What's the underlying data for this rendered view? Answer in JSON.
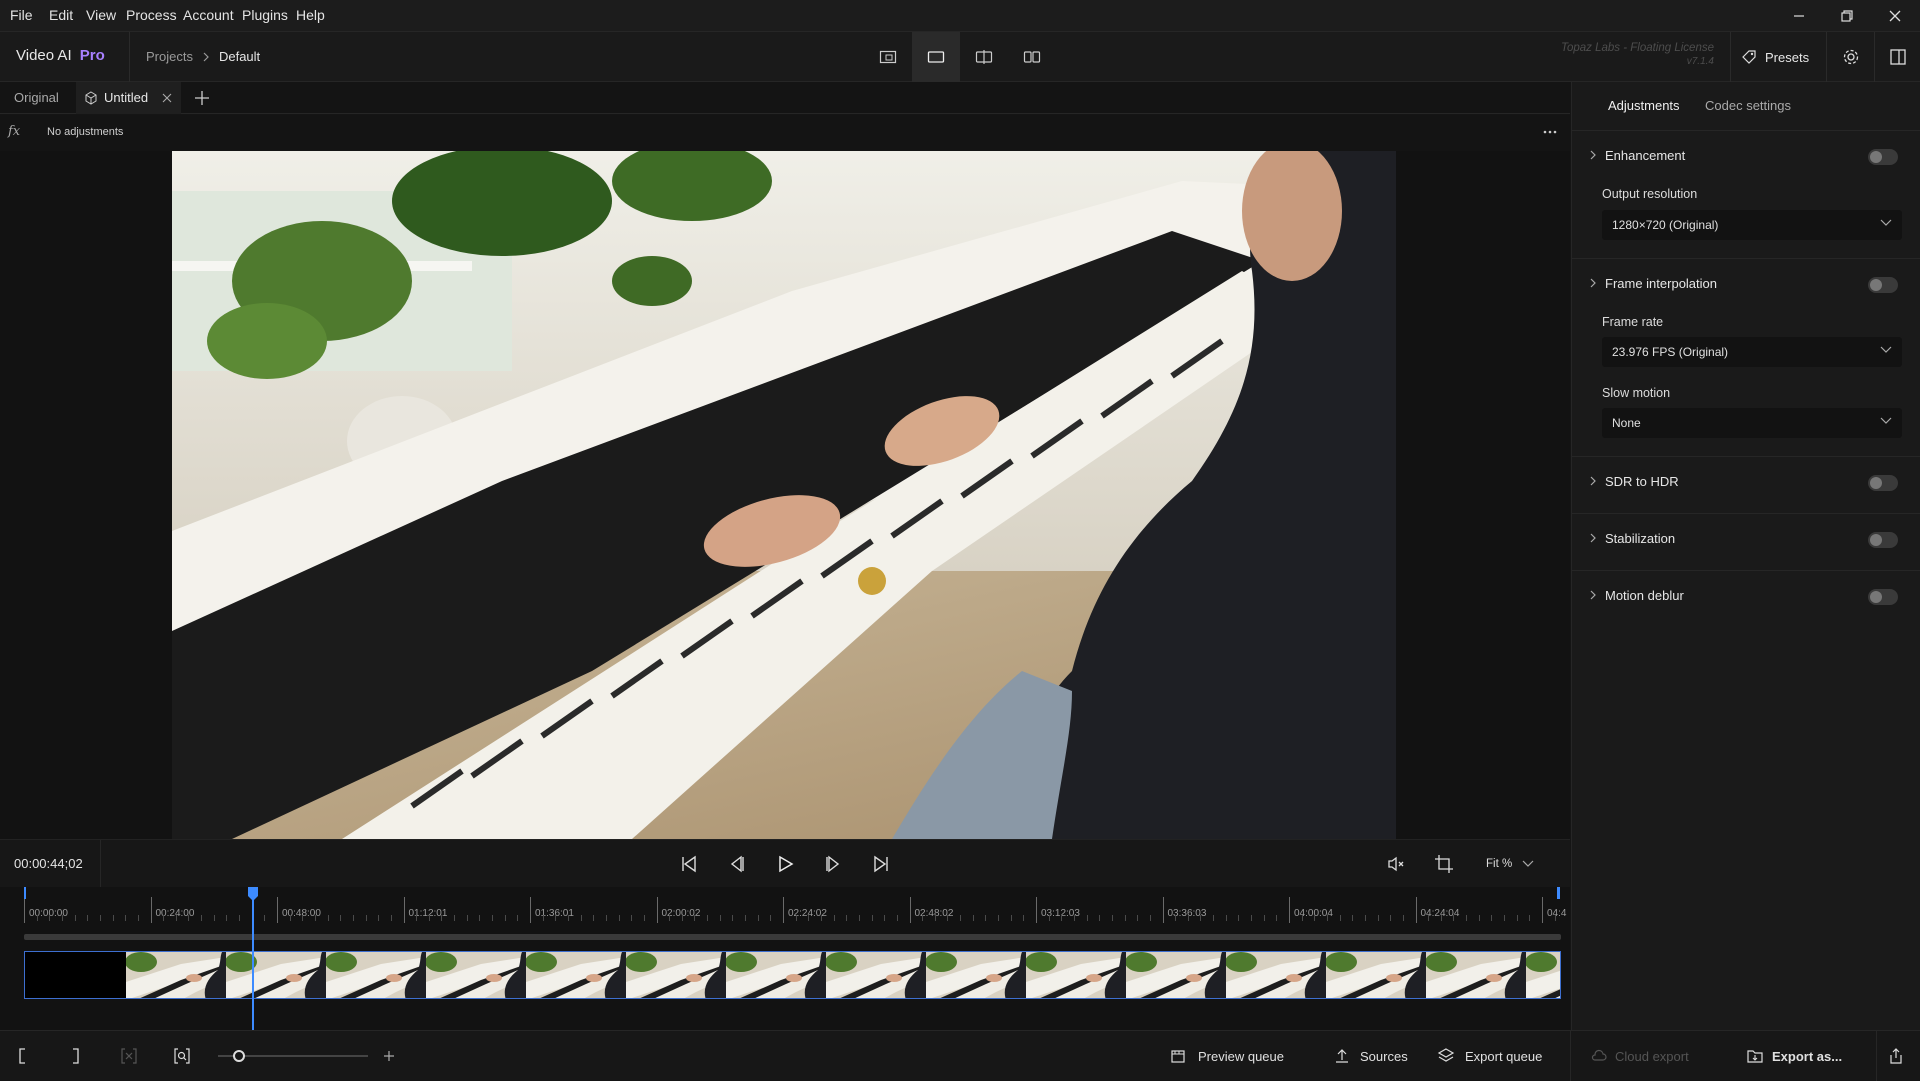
{
  "menu": [
    "File",
    "Edit",
    "View",
    "Process",
    "Account",
    "Plugins",
    "Help"
  ],
  "app": {
    "name": "Video AI",
    "edition": "Pro"
  },
  "breadcrumb": {
    "projects": "Projects",
    "current": "Default"
  },
  "license": {
    "text": "Topaz Labs - Floating License",
    "version": "v7.1.4"
  },
  "header": {
    "presets_label": "Presets"
  },
  "tabs": {
    "original": "Original",
    "untitled": "Untitled"
  },
  "adjustments_row": {
    "fx": "fx",
    "status": "No adjustments"
  },
  "transport": {
    "timecode": "00:00:44;02",
    "zoom": "Fit %"
  },
  "timeline": {
    "ticks": [
      "00:00:00",
      "00:24:00",
      "00:48:00",
      "01:12:01",
      "01:36:01",
      "02:00:02",
      "02:24:02",
      "02:48:02",
      "03:12:03",
      "03:36:03",
      "04:00:04",
      "04:24:04",
      "04:4"
    ],
    "playhead_fraction": 0.1487
  },
  "bottom": {
    "preview_queue": "Preview queue",
    "sources": "Sources",
    "export_queue": "Export queue",
    "cloud_export": "Cloud export",
    "export_as": "Export as..."
  },
  "panel": {
    "tabs": {
      "adjustments": "Adjustments",
      "codec": "Codec settings"
    },
    "enhancement": "Enhancement",
    "output_resolution_label": "Output resolution",
    "output_resolution_value": "1280×720 (Original)",
    "frame_interpolation": "Frame interpolation",
    "frame_rate_label": "Frame rate",
    "frame_rate_value": "23.976 FPS (Original)",
    "slow_motion_label": "Slow motion",
    "slow_motion_value": "None",
    "sdr_to_hdr": "SDR to HDR",
    "stabilization": "Stabilization",
    "motion_deblur": "Motion deblur"
  },
  "colors": {
    "accent": "#a880ff",
    "playhead": "#3d8bff"
  }
}
